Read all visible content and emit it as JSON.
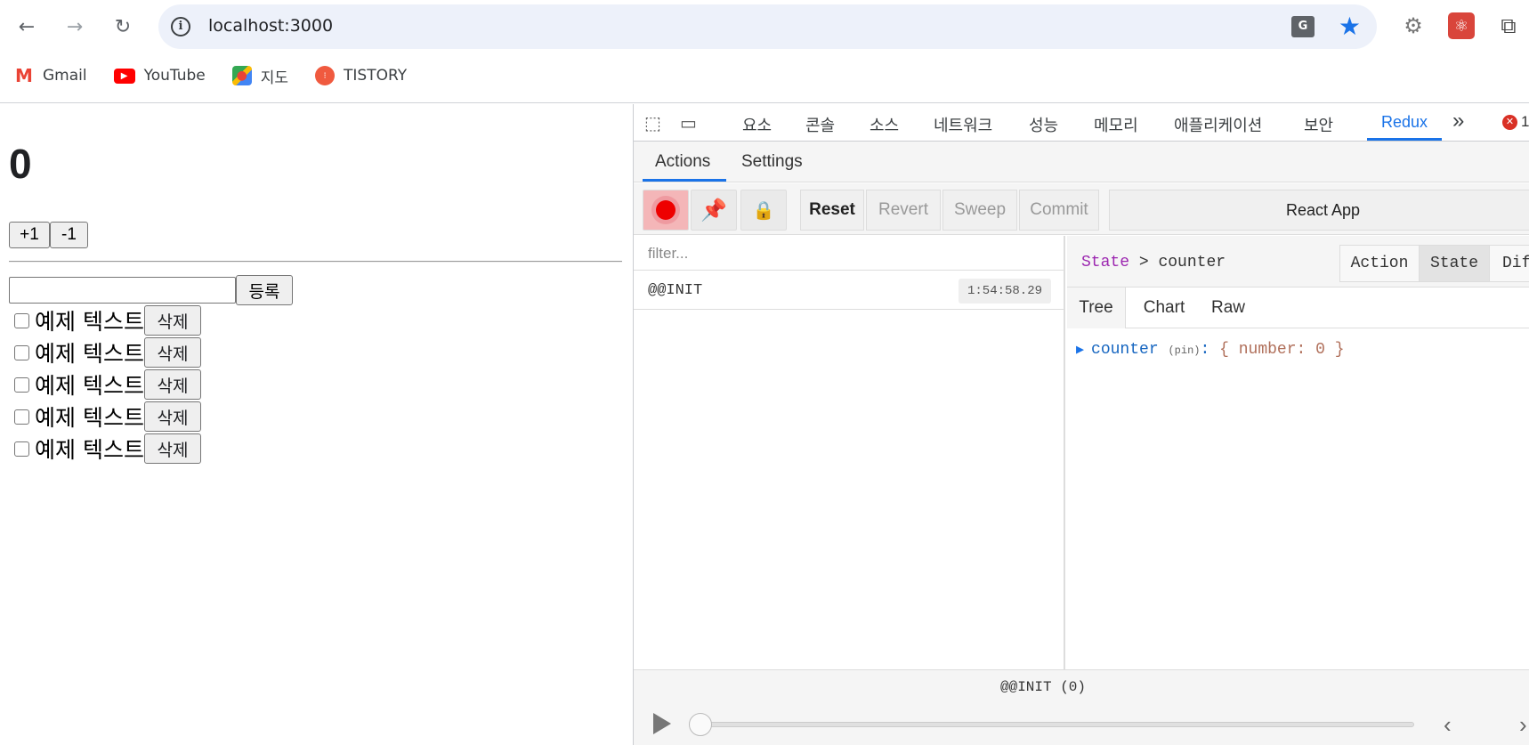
{
  "browser": {
    "url": "localhost:3000",
    "nav": {
      "back_icon": "←",
      "forward_icon": "→",
      "reload_icon": "↻"
    },
    "translate_icon_label": "G",
    "bookmarks": [
      {
        "label": "Gmail",
        "icon": "gmail-icon",
        "color": "#ea4335"
      },
      {
        "label": "YouTube",
        "icon": "youtube-icon",
        "color": "#ff0000"
      },
      {
        "label": "지도",
        "icon": "maps-icon",
        "color": "#34a853"
      },
      {
        "label": "TISTORY",
        "icon": "tistory-icon",
        "color": "#f05a3f"
      }
    ]
  },
  "app": {
    "counter": "0",
    "increment_label": "+1",
    "decrement_label": "-1",
    "input_value": "",
    "submit_label": "등록",
    "todos": [
      {
        "text": "예제 텍스트",
        "delete_label": "삭제"
      },
      {
        "text": "예제 텍스트",
        "delete_label": "삭제"
      },
      {
        "text": "예제 텍스트",
        "delete_label": "삭제"
      },
      {
        "text": "예제 텍스트",
        "delete_label": "삭제"
      },
      {
        "text": "예제 텍스트",
        "delete_label": "삭제"
      }
    ]
  },
  "devtools": {
    "tabs": [
      "요소",
      "콘솔",
      "소스",
      "네트워크",
      "성능",
      "메모리",
      "애플리케이션",
      "보안",
      "Redux"
    ],
    "active_tab": "Redux",
    "more_tabs_icon": "»",
    "error_count": "1",
    "redux": {
      "subtabs": [
        "Actions",
        "Settings"
      ],
      "toolbar": {
        "reset": "Reset",
        "revert": "Revert",
        "sweep": "Sweep",
        "commit": "Commit",
        "instance": "React App"
      },
      "filter_placeholder": "filter...",
      "actions": [
        {
          "type": "@@INIT",
          "time": "1:54:58.29"
        }
      ],
      "breadcrumb_root": "State",
      "breadcrumb_sep": ">",
      "breadcrumb_leaf": "counter",
      "panel_tabs": [
        "Action",
        "State",
        "Dif"
      ],
      "view_tabs": [
        "Tree",
        "Chart",
        "Raw"
      ],
      "tree": {
        "key": "counter",
        "pin": "(pin)",
        "colon": ":",
        "value": "{ number: 0 }"
      },
      "slider_label": "@@INIT (0)",
      "prev_icon": "‹",
      "next_icon": "›"
    }
  }
}
